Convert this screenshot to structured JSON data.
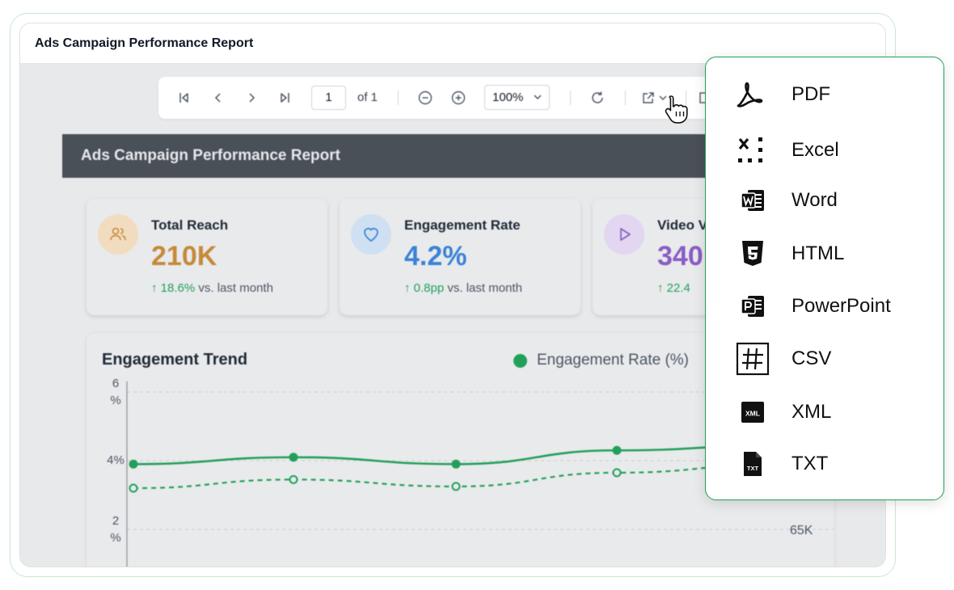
{
  "window": {
    "title": "Ads Campaign Performance Report"
  },
  "toolbar": {
    "page_current": "1",
    "page_total_label": "of 1",
    "zoom": "100%",
    "icons": [
      "first-page-icon",
      "prev-page-icon",
      "next-page-icon",
      "last-page-icon",
      "zoom-out-icon",
      "zoom-in-icon",
      "refresh-icon",
      "export-icon",
      "print-icon"
    ]
  },
  "report": {
    "title": "Ads Campaign Performance Report",
    "kpis": [
      {
        "label": "Total Reach",
        "value": "210K",
        "delta": "18.6%",
        "delta_suffix": " vs. last month",
        "value_color": "#c58a3a",
        "icon": "users-icon",
        "icon_bg": "#f2dcc0",
        "icon_color": "#c58a3a"
      },
      {
        "label": "Engagement Rate",
        "value": "4.2%",
        "delta": "0.8pp",
        "delta_suffix": " vs. last month",
        "value_color": "#3a82d6",
        "icon": "heart-icon",
        "icon_bg": "#cfe0f2",
        "icon_color": "#3a82d6"
      },
      {
        "label": "Video V",
        "value": "340",
        "delta": "22.4",
        "delta_suffix": "",
        "value_color": "#8a5cc4",
        "icon": "play-icon",
        "icon_bg": "#e2d6f0",
        "icon_color": "#8a5cc4"
      }
    ]
  },
  "chart": {
    "title": "Engagement Trend",
    "legend": "Engagement Rate (%)",
    "legend_color": "#22a05a"
  },
  "chart_data": {
    "type": "line",
    "title": "Engagement Trend",
    "x": [
      1,
      2,
      3,
      4,
      5
    ],
    "yticks": [
      "6\n%",
      "4%",
      "2\n%"
    ],
    "right_tick": "65K",
    "series": [
      {
        "name": "Engagement Rate (%)",
        "style": "solid",
        "values": [
          3.9,
          4.1,
          3.9,
          4.3,
          4.45
        ]
      },
      {
        "style": "dashed",
        "values": [
          3.2,
          3.45,
          3.25,
          3.65,
          3.9
        ]
      }
    ],
    "ylim": [
      1.5,
      6.5
    ],
    "grid": true
  },
  "export_menu": {
    "items": [
      {
        "label": "PDF",
        "icon": "pdf-icon"
      },
      {
        "label": "Excel",
        "icon": "excel-icon"
      },
      {
        "label": "Word",
        "icon": "word-icon"
      },
      {
        "label": "HTML",
        "icon": "html5-icon"
      },
      {
        "label": "PowerPoint",
        "icon": "powerpoint-icon"
      },
      {
        "label": "CSV",
        "icon": "csv-icon"
      },
      {
        "label": "XML",
        "icon": "xml-icon"
      },
      {
        "label": "TXT",
        "icon": "txt-icon"
      }
    ]
  }
}
